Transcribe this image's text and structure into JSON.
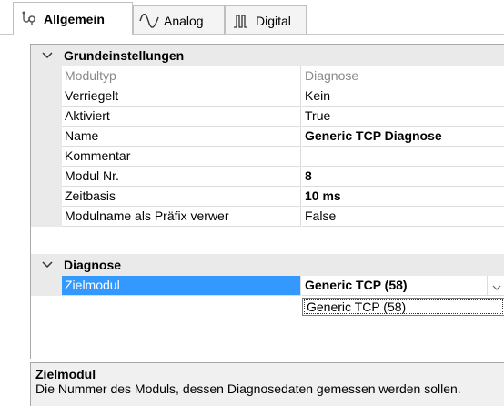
{
  "tabs": [
    {
      "label": "Allgemein",
      "icon": "settings-probe-icon",
      "active": true
    },
    {
      "label": "Analog",
      "icon": "analog-wave-icon",
      "active": false
    },
    {
      "label": "Digital",
      "icon": "digital-signal-icon",
      "active": false
    }
  ],
  "grid": {
    "category_1": "Grundeinstellungen",
    "rows_1": [
      {
        "name": "Modultyp",
        "value": "Diagnose"
      },
      {
        "name": "Verriegelt",
        "value": "Kein"
      },
      {
        "name": "Aktiviert",
        "value": "True"
      },
      {
        "name": "Name",
        "value": "Generic TCP Diagnose"
      },
      {
        "name": "Kommentar",
        "value": ""
      },
      {
        "name": "Modul Nr.",
        "value": "8"
      },
      {
        "name": "Zeitbasis",
        "value": "10 ms"
      },
      {
        "name": "Modulname als Präfix verwer",
        "value": "False"
      }
    ],
    "category_2": "Diagnose",
    "rows_2": [
      {
        "name": "Zielmodul",
        "value": "Generic TCP (58)"
      }
    ],
    "dropdown_option": "Generic TCP (58)"
  },
  "description": {
    "title": "Zielmodul",
    "text": "Die Nummer des Moduls, dessen Diagnosedaten gemessen werden sollen."
  },
  "colors": {
    "selection": "#3399ff",
    "category_bg": "#eaeaea"
  }
}
